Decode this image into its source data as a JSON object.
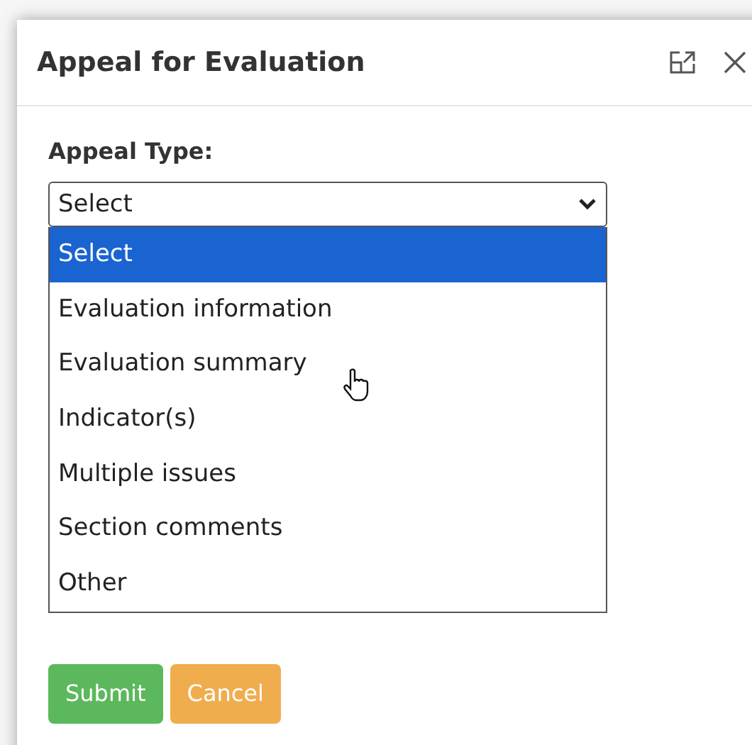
{
  "dialog": {
    "title": "Appeal for Evaluation"
  },
  "field": {
    "label": "Appeal Type:",
    "value": "Select",
    "expanded": true,
    "options": [
      {
        "label": "Select",
        "selected": true
      },
      {
        "label": "Evaluation information",
        "selected": false
      },
      {
        "label": "Evaluation summary",
        "selected": false
      },
      {
        "label": "Indicator(s)",
        "selected": false
      },
      {
        "label": "Multiple issues",
        "selected": false
      },
      {
        "label": "Section comments",
        "selected": false
      },
      {
        "label": "Other",
        "selected": false
      }
    ]
  },
  "buttons": [
    {
      "label": "Submit",
      "kind": "primary"
    },
    {
      "label": "Cancel",
      "kind": "warning"
    }
  ]
}
